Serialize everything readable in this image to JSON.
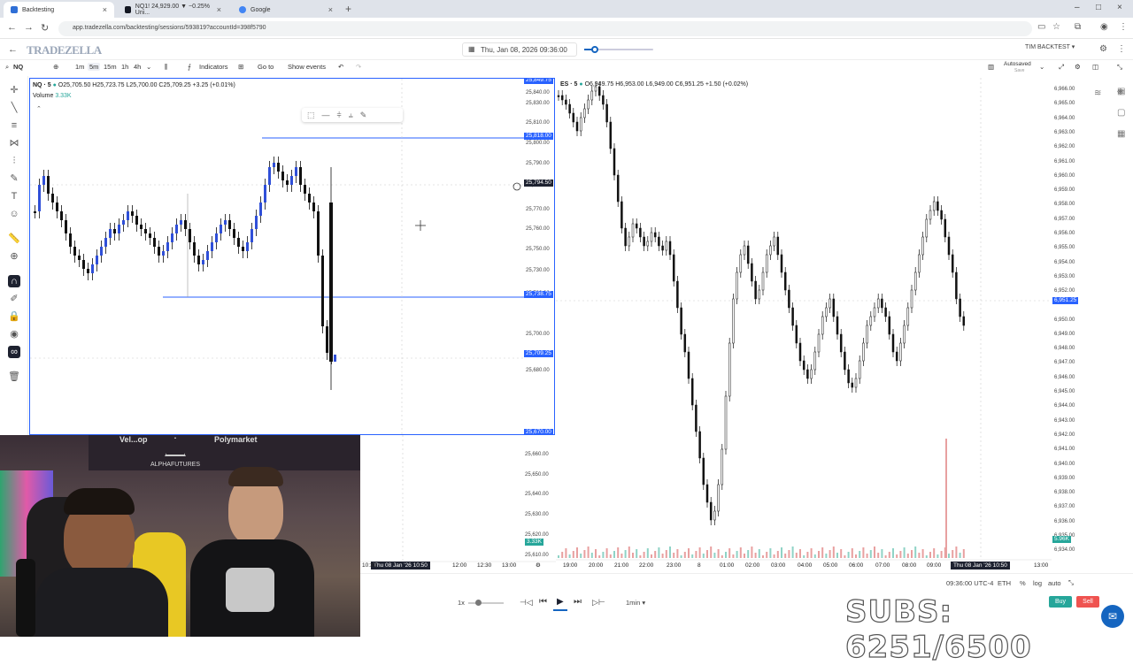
{
  "browser": {
    "tabs": [
      {
        "label": "Backtesting",
        "active": true,
        "color": "#2f6fd6"
      },
      {
        "label": "NQ1! 24,929.00 ▼ −0.25% Uni...",
        "active": false,
        "color": "#131722"
      },
      {
        "label": "Google",
        "active": false,
        "color": "#4285f4"
      }
    ],
    "new_tab": "+",
    "url": "app.tradezella.com/backtesting/sessions/593819?accountId=398f5790"
  },
  "header": {
    "logo": "TRADEZELLA",
    "datetime": "Thu, Jan 08, 2026 09:36:00",
    "account": "TIM BACKTEST ▾"
  },
  "toolbar": {
    "intervals": [
      "1m",
      "5m",
      "15m",
      "1h",
      "4h"
    ],
    "selected_interval": "5m",
    "indicators": "Indicators",
    "go_to": "Go to",
    "show_events": "Show events",
    "autosaved": "Autosaved",
    "autosaved_sub": "Save"
  },
  "chart_left": {
    "symbol": "NQ · 5",
    "ohlc": "O25,705.50 H25,723.75 L25,700.00 C25,709.25 +3.25 (+0.01%)",
    "volume_label": "Volume",
    "volume_value": "3.33K",
    "price_labels": [
      "25,840.00",
      "25,830.00",
      "25,810.00",
      "25,800.00",
      "25,790.00",
      "25,780.00",
      "25,770.00",
      "25,760.00",
      "25,750.00",
      "25,730.00",
      "25,720.00",
      "25,700.00",
      "25,690.00",
      "25,680.00"
    ],
    "tags": [
      {
        "text": "25,849.75",
        "price": 25849.75
      },
      {
        "text": "25,818.00",
        "price": 25818
      },
      {
        "text": "25,794.50",
        "price": 25794.5,
        "dark": true
      },
      {
        "text": "25,738.75",
        "price": 25738.75
      },
      {
        "text": "25,709.25",
        "price": 25709.25
      },
      {
        "text": "25,670.00",
        "price": 25670
      }
    ],
    "lower_price_labels": [
      "25,660.00",
      "25,650.00",
      "25,640.00",
      "25,630.00",
      "25,620.00",
      "25,610.00"
    ],
    "lower_volume_tag": "3.33K",
    "time_labels": [
      "12:00",
      "12:30",
      "13:00"
    ],
    "time_selected": "Thu 08 Jan '26   10:50",
    "time_clip": "10:30"
  },
  "chart_right": {
    "symbol": "ES · 5",
    "ohlc": "O6,949.75 H6,953.00 L6,949.00 C6,951.25 +1.50 (+0.02%)",
    "price_labels": [
      "6,966.00",
      "6,965.00",
      "6,964.00",
      "6,963.00",
      "6,962.00",
      "6,961.00",
      "6,960.00",
      "6,959.00",
      "6,958.00",
      "6,957.00",
      "6,956.00",
      "6,955.00",
      "6,954.00",
      "6,953.00",
      "6,952.00",
      "6,950.00",
      "6,949.00",
      "6,948.00",
      "6,947.00",
      "6,946.00",
      "6,945.00",
      "6,944.00",
      "6,943.00",
      "6,942.00",
      "6,941.00",
      "6,940.00",
      "6,939.00",
      "6,938.00",
      "6,937.00",
      "6,936.00",
      "6,935.00",
      "6,934.00"
    ],
    "current_tag": "6,951.25",
    "volume_tag": "5.96K",
    "time_labels": [
      "19:00",
      "20:00",
      "21:00",
      "22:00",
      "23:00",
      "8",
      "01:00",
      "02:00",
      "03:00",
      "04:00",
      "05:00",
      "06:00",
      "07:00",
      "08:00",
      "09:00",
      "11:00",
      "13:00"
    ],
    "time_selected": "Thu 08 Jan '26   10:50"
  },
  "playback": {
    "speed": "1x",
    "interval": "1min",
    "timezone": "09:36:00 UTC-4",
    "session": "ETH",
    "percent": "%",
    "log": "log",
    "auto": "auto",
    "buy": "Buy",
    "sell": "Sell"
  },
  "overlay": {
    "watermark": "SUBS: 6251/6500",
    "webcam_banner_left": "Vel...op",
    "webcam_banner_right": "Polymarket",
    "webcam_logo": "ALPHAFUTURES"
  }
}
